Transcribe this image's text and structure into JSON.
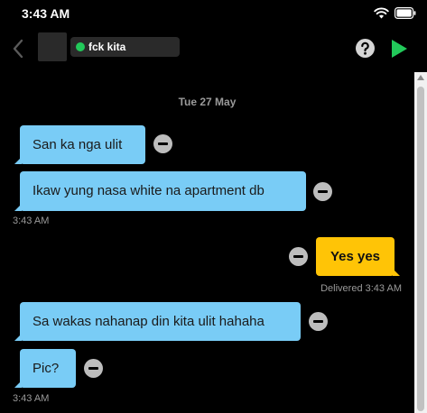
{
  "status_bar": {
    "time": "3:43 AM"
  },
  "header": {
    "contact_name": "fck kita"
  },
  "chat": {
    "date": "Tue 27 May",
    "messages": [
      {
        "text": "San ka nga ulit"
      },
      {
        "text": "Ikaw yung nasa white na apartment db"
      },
      {
        "text": "Yes yes"
      },
      {
        "text": "Sa wakas nahanap din kita ulit hahaha"
      },
      {
        "text": "Pic?"
      }
    ],
    "timestamps": {
      "group1": "3:43 AM",
      "sent": "Delivered 3:43 AM",
      "group2": "3:43 AM"
    }
  },
  "colors": {
    "incoming_bubble": "#79ccf6",
    "outgoing_bubble": "#ffc406",
    "online": "#22c95a",
    "send_button": "#22c95a",
    "background": "#000000"
  },
  "icons": [
    "wifi-icon",
    "battery-icon",
    "back-chevron-icon",
    "help-icon",
    "play-icon",
    "remove-icon"
  ]
}
